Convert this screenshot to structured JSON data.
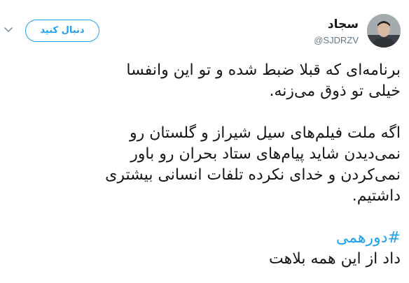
{
  "user": {
    "name": "سجاد",
    "handle": "@SJDRZV",
    "avatar_icon": "user-avatar"
  },
  "follow_button": {
    "label": "دنبال کنید"
  },
  "menu_icon": "chevron-down-icon",
  "tweet": {
    "paragraph1_line1": "برنامه‌ای که قبلا ضبط شده و تو این وانفسا",
    "paragraph1_line2": "خیلی تو ذوق می‌زنه.",
    "paragraph2_line1": "اگه ملت فیلم‌های سیل شیراز و گلستان رو",
    "paragraph2_line2": "نمی‌دیدن شاید پیام‌های ستاد بحران رو باور",
    "paragraph2_line3": "نمی‌کردن و خدای نکرده تلفات انسانی بیشتری",
    "paragraph2_line4": "داشتیم.",
    "hashtag": "#دورهمی",
    "final_line": "داد از این همه بلاهت"
  },
  "colors": {
    "accent": "#1da1f2",
    "text": "#14171a",
    "muted": "#657786"
  }
}
